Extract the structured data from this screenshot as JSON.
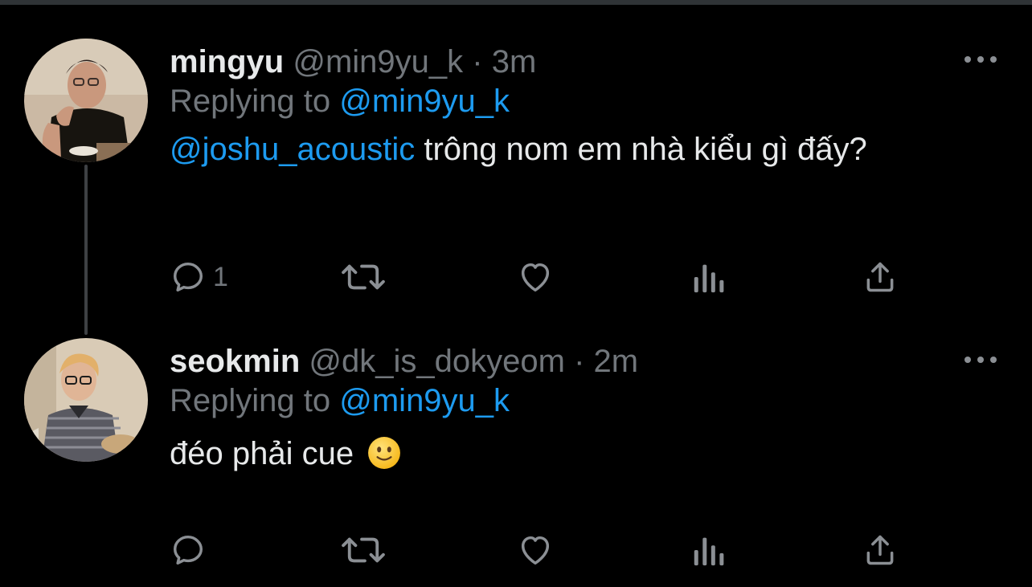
{
  "tweets": [
    {
      "display_name": "mingyu",
      "handle": "@min9yu_k",
      "dot": "·",
      "time": "3m",
      "replying_prefix": "Replying to",
      "replying_to": "@min9yu_k",
      "body_mention": "@joshu_acoustic",
      "body_text": " trông nom em nhà kiểu gì đấy?",
      "reply_count": "1",
      "avatar": "avatar-mingyu"
    },
    {
      "display_name": "seokmin",
      "handle": "@dk_is_dokyeom",
      "dot": "·",
      "time": "2m",
      "replying_prefix": "Replying to",
      "replying_to": "@min9yu_k",
      "body_text": "đéo phải cue",
      "body_emoji": "slightly-smiling-face",
      "reply_count": "",
      "avatar": "avatar-seokmin"
    }
  ],
  "icons": [
    "reply-icon",
    "retweet-icon",
    "like-icon",
    "analytics-icon",
    "share-icon",
    "more-icon"
  ],
  "colors": {
    "background": "#000000",
    "text_primary": "#e7e9ea",
    "text_secondary": "#71767b",
    "link": "#1d9bf0",
    "thread_line": "#3e4144"
  }
}
